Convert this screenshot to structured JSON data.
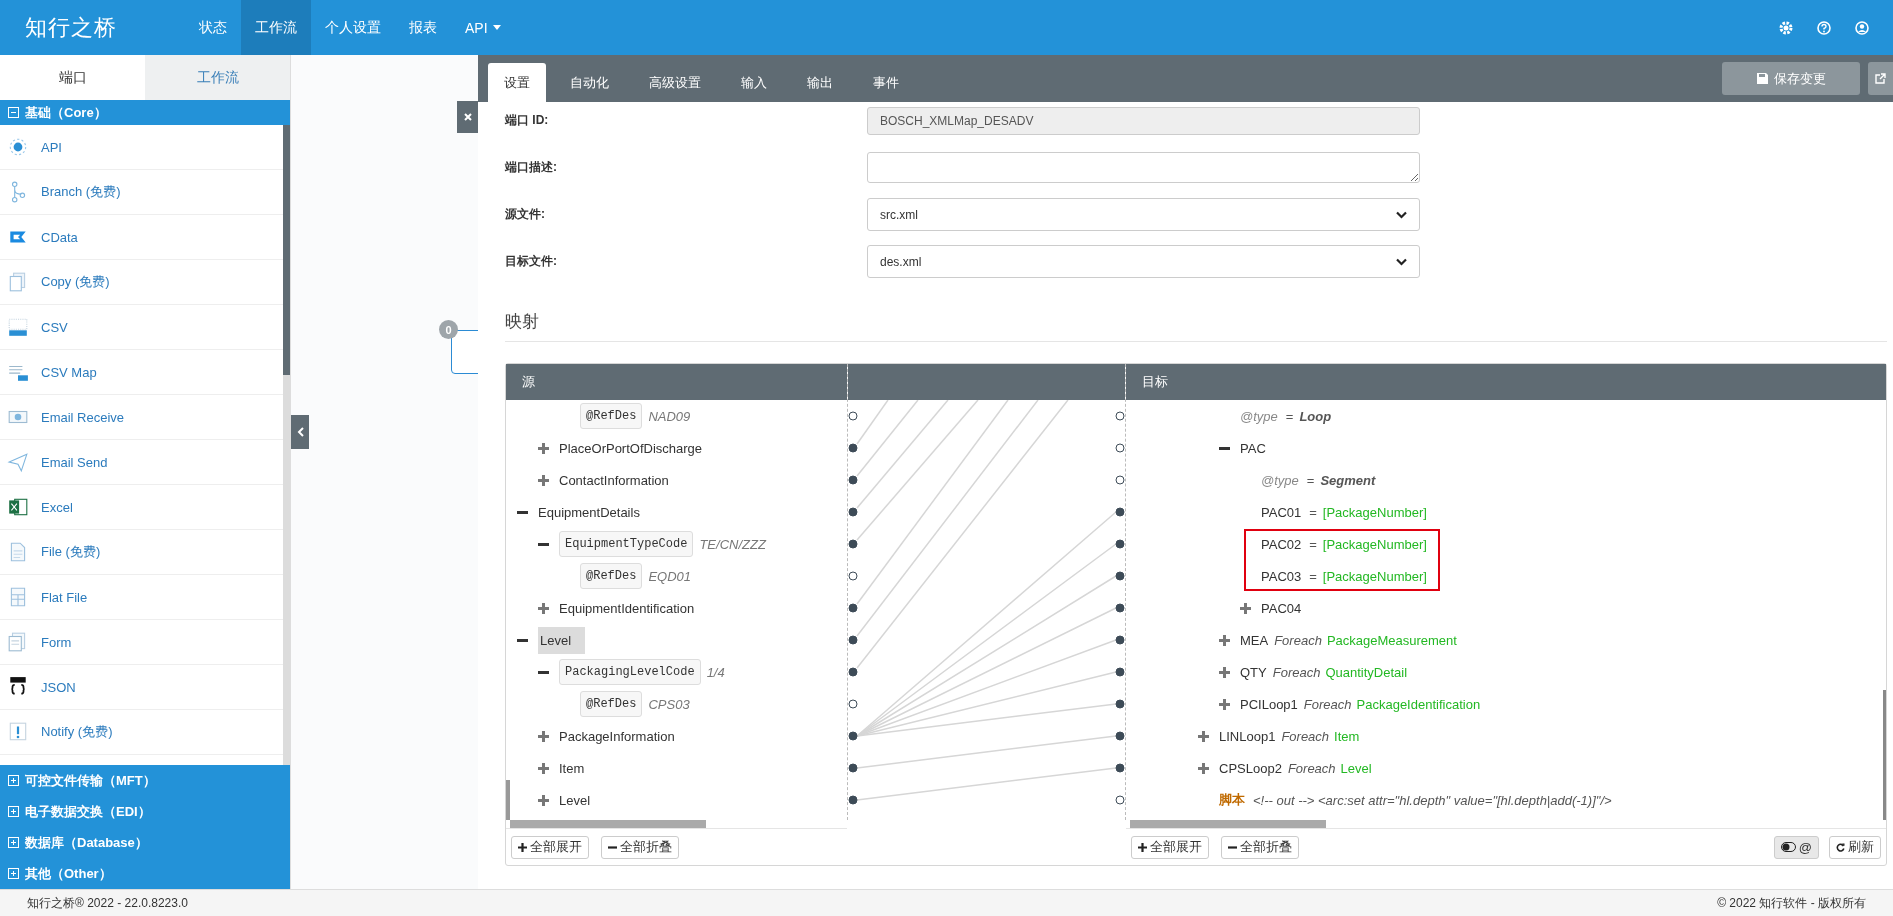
{
  "nav": {
    "logo": "知行之桥",
    "items": [
      {
        "label": "状态",
        "selected": false
      },
      {
        "label": "工作流",
        "selected": true
      },
      {
        "label": "个人设置",
        "selected": false
      },
      {
        "label": "报表",
        "selected": false
      },
      {
        "label": "API",
        "selected": false,
        "dropdown": true
      }
    ]
  },
  "sidebar": {
    "tabs": [
      {
        "label": "端口",
        "selected": true
      },
      {
        "label": "工作流",
        "selected": false
      }
    ],
    "groups": [
      {
        "label": "基础（Core）",
        "expanded": true,
        "items": [
          {
            "label": "API"
          },
          {
            "label": "Branch (免费)"
          },
          {
            "label": "CData"
          },
          {
            "label": "Copy (免费)"
          },
          {
            "label": "CSV"
          },
          {
            "label": "CSV Map"
          },
          {
            "label": "Email Receive"
          },
          {
            "label": "Email Send"
          },
          {
            "label": "Excel"
          },
          {
            "label": "File (免费)"
          },
          {
            "label": "Flat File"
          },
          {
            "label": "Form"
          },
          {
            "label": "JSON"
          },
          {
            "label": "Notify (免费)"
          }
        ]
      },
      {
        "label": "可控文件传输（MFT）",
        "expanded": false
      },
      {
        "label": "电子数据交换（EDI）",
        "expanded": false
      },
      {
        "label": "数据库（Database）",
        "expanded": false
      },
      {
        "label": "其他（Other）",
        "expanded": false
      }
    ]
  },
  "canvas": {
    "node_badge": "0"
  },
  "panel": {
    "tabs": [
      {
        "label": "设置",
        "selected": true
      },
      {
        "label": "自动化",
        "selected": false
      },
      {
        "label": "高级设置",
        "selected": false
      },
      {
        "label": "输入",
        "selected": false
      },
      {
        "label": "输出",
        "selected": false
      },
      {
        "label": "事件",
        "selected": false
      }
    ],
    "save_button": "保存变更",
    "form": [
      {
        "label": "端口 ID:",
        "kind": "text",
        "value": "BOSCH_XMLMap_DESADV",
        "disabled": true
      },
      {
        "label": "端口描述:",
        "kind": "textarea",
        "disabled": false
      },
      {
        "label": "源文件:",
        "kind": "select",
        "value": "src.xml",
        "disabled": false
      },
      {
        "label": "目标文件:",
        "kind": "select",
        "value": "des.xml",
        "disabled": false
      }
    ]
  },
  "mapping": {
    "title": "映射",
    "source": {
      "title": "源",
      "tree": [
        {
          "children": [
            {
              "children": [
                {
                  "kind": "field",
                  "name": "@RefDes",
                  "value": "NAD09",
                  "mapped": false,
                  "selected": false
                }
              ]
            },
            {
              "kind": "element",
              "name": "PlaceOrPortOfDischarge",
              "expanded": false,
              "mapped": true,
              "selected": false
            },
            {
              "kind": "element",
              "name": "ContactInformation",
              "expanded": false,
              "mapped": true,
              "selected": false
            }
          ]
        },
        {
          "kind": "element",
          "name": "EquipmentDetails",
          "expanded": true,
          "mapped": true,
          "selected": false,
          "children": [
            {
              "kind": "field",
              "name": "EquipmentTypeCode",
              "value": "TE/CN/ZZZ",
              "expanded": true,
              "mapped": true,
              "selected": false,
              "children": [
                {
                  "kind": "field",
                  "name": "@RefDes",
                  "value": "EQD01",
                  "mapped": false,
                  "selected": false
                }
              ]
            },
            {
              "kind": "element",
              "name": "EquipmentIdentification",
              "expanded": false,
              "mapped": true,
              "selected": false
            }
          ]
        },
        {
          "kind": "element",
          "name": "Level",
          "expanded": true,
          "mapped": true,
          "selected": true,
          "children": [
            {
              "kind": "field",
              "name": "PackagingLevelCode",
              "value": "1/4",
              "expanded": true,
              "mapped": true,
              "selected": false,
              "children": [
                {
                  "kind": "field",
                  "name": "@RefDes",
                  "value": "CPS03",
                  "mapped": false,
                  "selected": false
                }
              ]
            },
            {
              "kind": "element",
              "name": "PackageInformation",
              "expanded": false,
              "mapped": true,
              "selected": false
            },
            {
              "kind": "element",
              "name": "Item",
              "expanded": false,
              "mapped": true,
              "selected": false
            },
            {
              "kind": "element",
              "name": "Level",
              "expanded": false,
              "mapped": true,
              "selected": false
            }
          ]
        }
      ],
      "buttons": [
        {
          "label": "全部展开",
          "kind": "expand"
        },
        {
          "label": "全部折叠",
          "kind": "collapse"
        }
      ]
    },
    "target": {
      "title": "目标",
      "tree": [
        {
          "children": [
            {
              "children": [
                {
                  "kind": "attribute",
                  "name": "@type",
                  "operator": "=",
                  "value": "Loop",
                  "mapped": false
                },
                {
                  "kind": "element",
                  "name": "PAC",
                  "expanded": true,
                  "mapped": false,
                  "children": [
                    {
                      "kind": "attribute",
                      "name": "@type",
                      "operator": "=",
                      "value": "Segment",
                      "mapped": false
                    },
                    {
                      "kind": "element",
                      "name": "PAC01",
                      "operator": "=",
                      "value": "[PackageNumber]",
                      "mapped": true,
                      "highlighted": false
                    },
                    {
                      "kind": "element",
                      "name": "PAC02",
                      "operator": "=",
                      "value": "[PackageNumber]",
                      "mapped": true,
                      "highlighted": true
                    },
                    {
                      "kind": "element",
                      "name": "PAC03",
                      "operator": "=",
                      "value": "[PackageNumber]",
                      "mapped": true,
                      "highlighted": true
                    },
                    {
                      "kind": "element",
                      "name": "PAC04",
                      "expanded": false,
                      "mapped": true,
                      "highlighted": false
                    }
                  ]
                },
                {
                  "kind": "loop",
                  "name": "MEA",
                  "keyword": "Foreach",
                  "value": "PackageMeasurement",
                  "expanded": false,
                  "mapped": true
                },
                {
                  "kind": "loop",
                  "name": "QTY",
                  "keyword": "Foreach",
                  "value": "QuantityDetail",
                  "expanded": false,
                  "mapped": true
                },
                {
                  "kind": "loop",
                  "name": "PCILoop1",
                  "keyword": "Foreach",
                  "value": "PackageIdentification",
                  "expanded": false,
                  "mapped": true
                }
              ]
            },
            {
              "kind": "loop",
              "name": "LINLoop1",
              "keyword": "Foreach",
              "value": "Item",
              "expanded": false,
              "mapped": true
            },
            {
              "kind": "loop",
              "name": "CPSLoop2",
              "keyword": "Foreach",
              "value": "Level",
              "expanded": false,
              "mapped": true
            },
            {
              "kind": "script",
              "name": "脚本",
              "value": "<!-- out --> <arc:set attr=\"hl.depth\" value=\"[hl.depth|add(-1)]\"/>",
              "mapped": false
            }
          ]
        }
      ],
      "buttons": [
        {
          "label": "全部展开",
          "kind": "expand"
        },
        {
          "label": "全部折叠",
          "kind": "collapse"
        }
      ],
      "attributes_toggle": {
        "label": "@",
        "on": false
      },
      "refresh_button": "刷新"
    }
  },
  "footer": {
    "version": "知行之桥® 2022 - 22.0.8223.0",
    "copyright": "© 2022 知行软件 - 版权所有"
  }
}
